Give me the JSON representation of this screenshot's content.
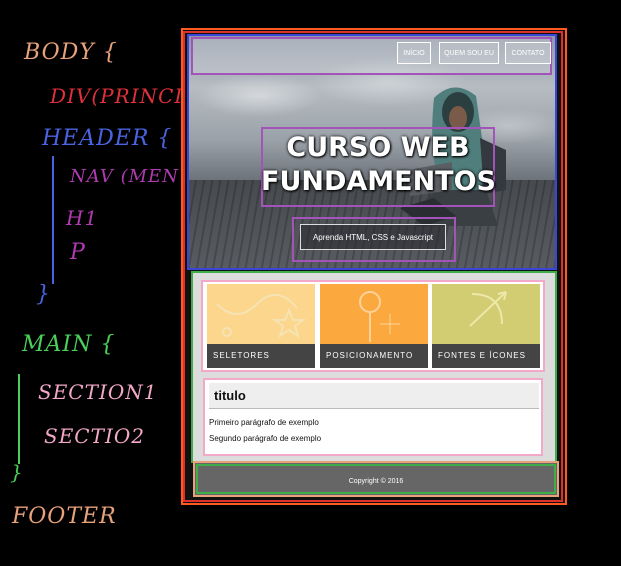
{
  "annotations": {
    "body": "BODY {",
    "div": "DIV(PRINCIPAL)",
    "header": "HEADER {",
    "nav": "NAV (MENU)",
    "h1": "H1",
    "p": "P",
    "close_header": "}",
    "main": "MAIN {",
    "section1": "SECTION1",
    "section2": "SECTIO2",
    "close_main": "}",
    "footer": "FOOTER"
  },
  "nav": {
    "items": [
      "INÍCIO",
      "QUEM SOU EU",
      "CONTATO"
    ]
  },
  "hero": {
    "title_line1": "CURSO WEB",
    "title_line2": "FUNDAMENTOS",
    "subtitle": "Aprenda HTML, CSS e Javascript"
  },
  "cards": [
    {
      "label": "SELETORES",
      "color": "#fbd68c"
    },
    {
      "label": "POSICIONAMENTO",
      "color": "#fba93f"
    },
    {
      "label": "FONTES E ÍCONES",
      "color": "#d2cd73"
    }
  ],
  "section2": {
    "title": "titulo",
    "paragraphs": [
      "Primeiro parágrafo de exemplo",
      "Segundo parágrafo de exemplo"
    ]
  },
  "footer": {
    "copyright": "Copyright © 2016"
  }
}
